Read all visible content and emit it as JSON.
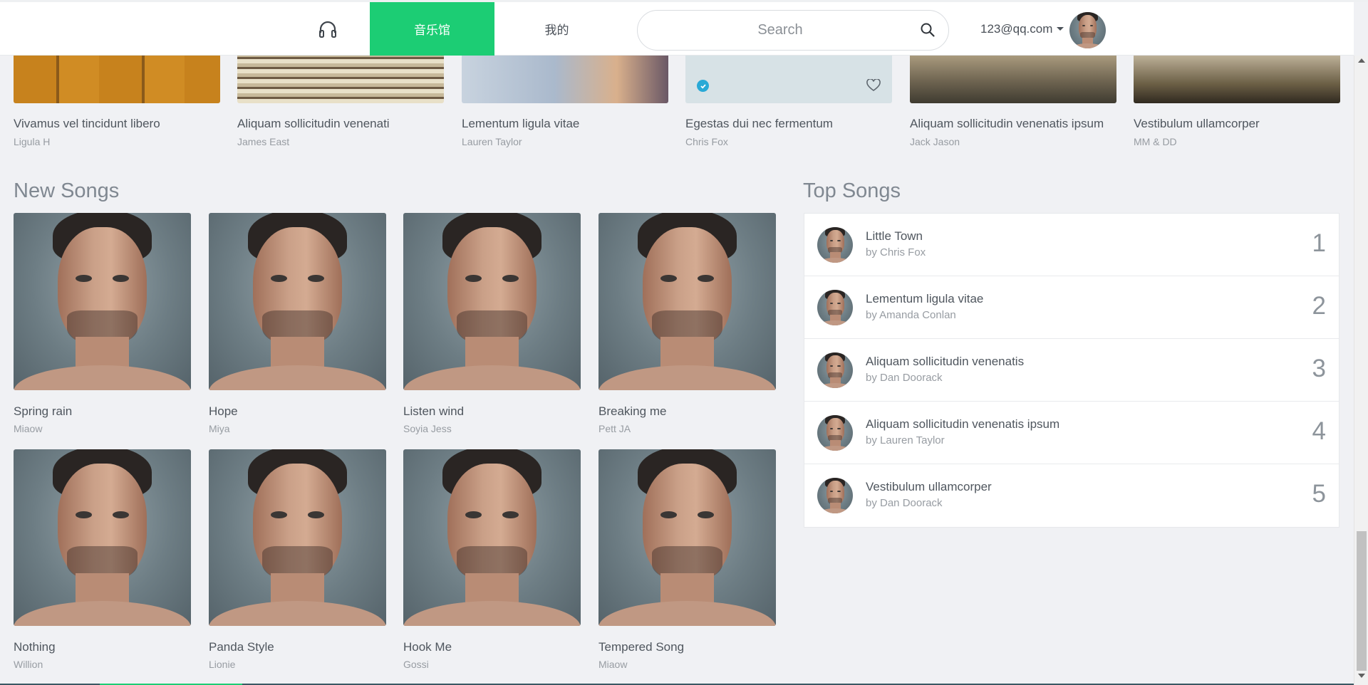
{
  "nav": {
    "tabs": [
      {
        "label": "音乐馆",
        "active": true
      },
      {
        "label": "我的",
        "active": false
      }
    ],
    "search": {
      "placeholder": "Search",
      "value": ""
    },
    "user": {
      "email": "123@qq.com"
    }
  },
  "albums": [
    {
      "title": "Vivamus vel tincidunt libero",
      "artist": "Ligula H"
    },
    {
      "title": "Aliquam sollicitudin venenati",
      "artist": "James East"
    },
    {
      "title": "Lementum ligula vitae",
      "artist": "Lauren Taylor"
    },
    {
      "title": "Egestas dui nec fermentum",
      "artist": "Chris Fox"
    },
    {
      "title": "Aliquam sollicitudin venenatis ipsum",
      "artist": "Jack Jason"
    },
    {
      "title": "Vestibulum ullamcorper",
      "artist": "MM & DD"
    }
  ],
  "new_songs": {
    "heading": "New Songs",
    "items": [
      {
        "title": "Spring rain",
        "artist": "Miaow"
      },
      {
        "title": "Hope",
        "artist": "Miya"
      },
      {
        "title": "Listen wind",
        "artist": "Soyia Jess"
      },
      {
        "title": "Breaking me",
        "artist": "Pett JA"
      },
      {
        "title": "Nothing",
        "artist": "Willion"
      },
      {
        "title": "Panda Style",
        "artist": "Lionie"
      },
      {
        "title": "Hook Me",
        "artist": "Gossi"
      },
      {
        "title": "Tempered Song",
        "artist": "Miaow"
      }
    ]
  },
  "top_songs": {
    "heading": "Top Songs",
    "items": [
      {
        "title": "Little Town",
        "by": "by Chris Fox",
        "rank": "1"
      },
      {
        "title": "Lementum ligula vitae",
        "by": "by Amanda Conlan",
        "rank": "2"
      },
      {
        "title": "Aliquam sollicitudin venenatis",
        "by": "by Dan Doorack",
        "rank": "3"
      },
      {
        "title": "Aliquam sollicitudin venenatis ipsum",
        "by": "by Lauren Taylor",
        "rank": "4"
      },
      {
        "title": "Vestibulum ullamcorper",
        "by": "by Dan Doorack",
        "rank": "5"
      }
    ]
  },
  "colors": {
    "accent": "#1ccd74",
    "background": "#f0f1f4",
    "check": "#29a9d6"
  }
}
